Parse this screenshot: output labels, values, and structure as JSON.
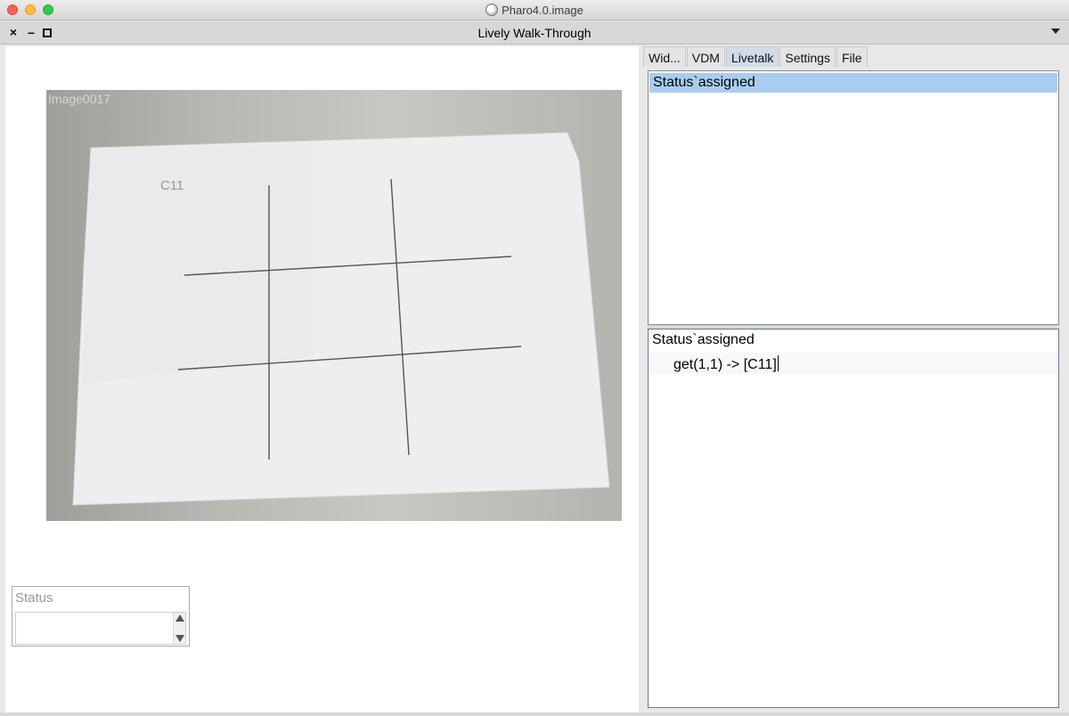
{
  "mac_window": {
    "title": "Pharo4.0.image"
  },
  "pharo_window": {
    "title": "Lively Walk-Through",
    "close": "×",
    "minimize": "–"
  },
  "canvas": {
    "photo_watermark": "Image0017",
    "grid_label": "C11",
    "status_widget": {
      "label": "Status",
      "value": ""
    }
  },
  "tabs": [
    {
      "label": "Wid..."
    },
    {
      "label": "VDM"
    },
    {
      "label": "Livetalk",
      "active": true
    },
    {
      "label": "Settings"
    },
    {
      "label": "File"
    }
  ],
  "list": {
    "items": [
      {
        "label": "Status`assigned",
        "selected": true
      }
    ]
  },
  "code": {
    "line1": "Status`assigned",
    "line2": "get(1,1) -> [C11]"
  }
}
